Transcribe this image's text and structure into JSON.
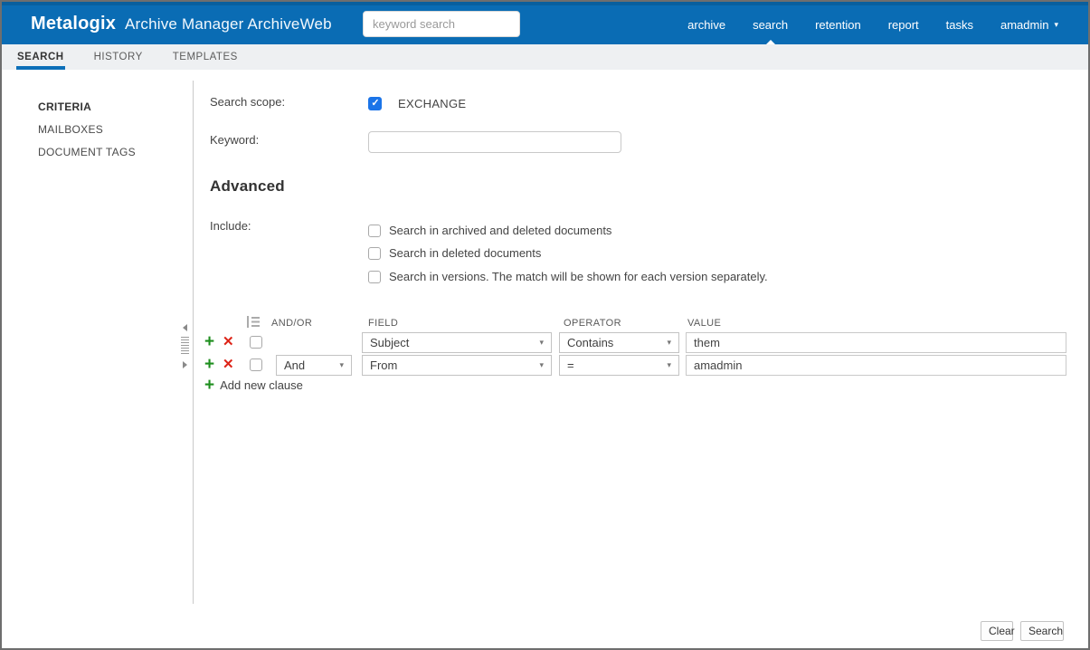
{
  "header": {
    "logo": "Metalogix",
    "product": "Archive Manager ArchiveWeb",
    "search_placeholder": "keyword search",
    "nav": [
      {
        "label": "archive",
        "active": false
      },
      {
        "label": "search",
        "active": true
      },
      {
        "label": "retention",
        "active": false
      },
      {
        "label": "report",
        "active": false
      },
      {
        "label": "tasks",
        "active": false
      }
    ],
    "user": {
      "label": "amadmin"
    }
  },
  "tabs": [
    {
      "label": "SEARCH",
      "active": true
    },
    {
      "label": "HISTORY",
      "active": false
    },
    {
      "label": "TEMPLATES",
      "active": false
    }
  ],
  "sidebar": {
    "items": [
      {
        "label": "CRITERIA",
        "active": true
      },
      {
        "label": "MAILBOXES",
        "active": false
      },
      {
        "label": "DOCUMENT TAGS",
        "active": false
      }
    ]
  },
  "criteria": {
    "search_scope_label": "Search scope:",
    "scope_checkbox": {
      "label": "EXCHANGE",
      "checked": true
    },
    "keyword_label": "Keyword:",
    "keyword_value": "",
    "advanced_heading": "Advanced",
    "include_label": "Include:",
    "include_options": [
      {
        "label": "Search in archived and deleted documents",
        "checked": false
      },
      {
        "label": "Search in deleted documents",
        "checked": false
      },
      {
        "label": "Search in versions. The match will be shown for each version separately.",
        "checked": false
      }
    ]
  },
  "clauses": {
    "columns": {
      "andor": "AND/OR",
      "field": "FIELD",
      "operator": "OPERATOR",
      "value": "VALUE"
    },
    "rows": [
      {
        "andor": "",
        "field": "Subject",
        "operator": "Contains",
        "value": "them",
        "checked": false
      },
      {
        "andor": "And",
        "field": "From",
        "operator": "=",
        "value": "amadmin",
        "checked": false
      }
    ],
    "add_label": "Add new clause"
  },
  "footer": {
    "clear_label": "Clear",
    "search_label": "Search"
  },
  "colors": {
    "header_bg": "#0a6cb4",
    "header_top_strip": "#085f9e",
    "tab_underline": "#0c6fb8",
    "checkbox_checked": "#1b74e8",
    "add_green": "#1e8e1e",
    "delete_red": "#dd2418"
  }
}
